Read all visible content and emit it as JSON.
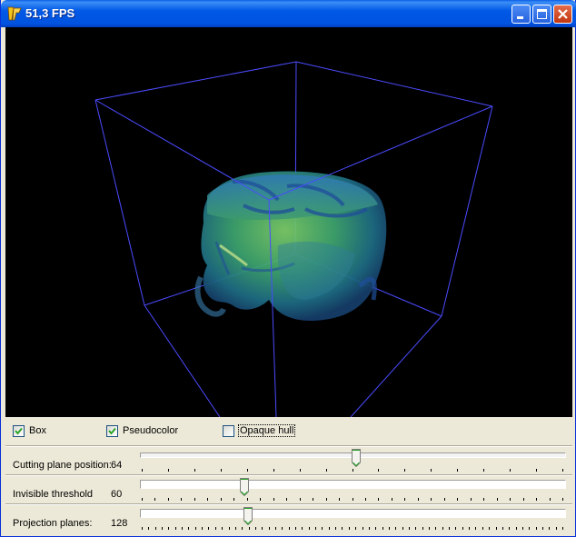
{
  "window": {
    "title": "51,3 FPS",
    "icon": "app-logo-icon"
  },
  "title_buttons": [
    {
      "name": "minimize-button",
      "icon": "minimize-icon"
    },
    {
      "name": "maximize-button",
      "icon": "maximize-icon"
    },
    {
      "name": "close-button",
      "icon": "close-icon"
    }
  ],
  "viewport": {
    "background": "#000000",
    "box_color": "#4B4BFF",
    "description_icon": "volume-render-head-icon"
  },
  "checkboxes": [
    {
      "label": "Box",
      "checked": true
    },
    {
      "label": "Pseudocolor",
      "checked": true
    },
    {
      "label": "Opaque hull",
      "checked": false
    }
  ],
  "sliders": [
    {
      "label": "Cutting plane position:",
      "value": "64",
      "fraction": 0.51
    },
    {
      "label": "Invisible threshold",
      "value": "60",
      "fraction": 0.24
    },
    {
      "label": "Projection planes:",
      "value": "128",
      "fraction": 0.25
    }
  ],
  "colors": {
    "title_bar": "#0054E3",
    "face": "#ECE9D8",
    "head_tint": "#3FA870"
  }
}
